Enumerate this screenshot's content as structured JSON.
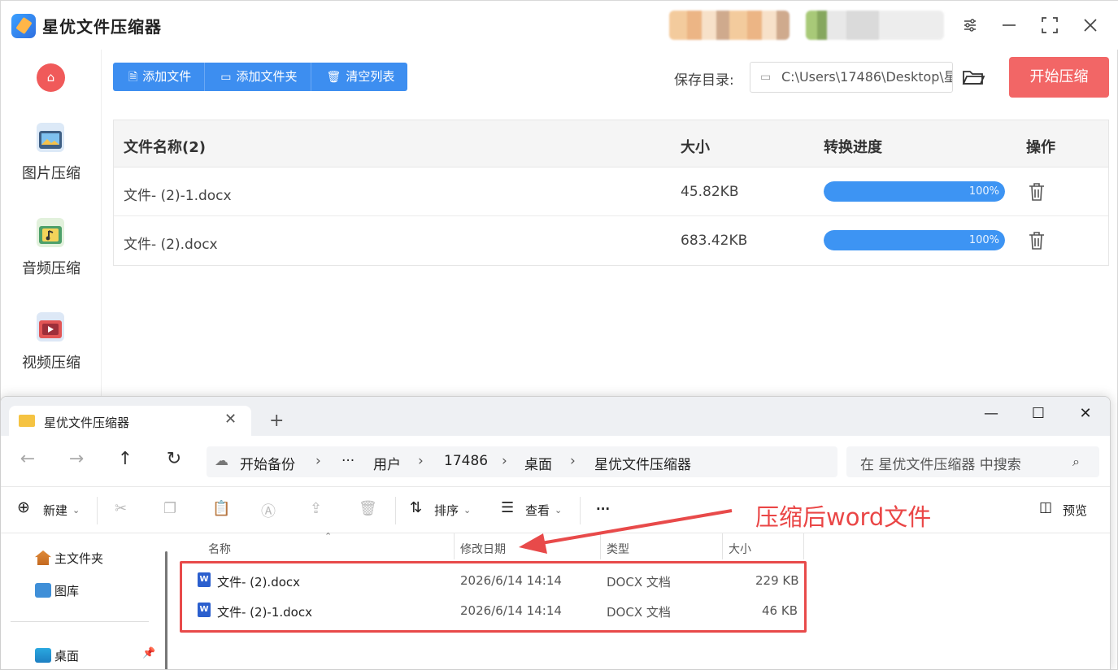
{
  "app": {
    "title": "星优文件压缩器",
    "sidebar": [
      {
        "label": "图片压缩",
        "icon": "image-compress-icon"
      },
      {
        "label": "音频压缩",
        "icon": "audio-compress-icon"
      },
      {
        "label": "视频压缩",
        "icon": "video-compress-icon"
      }
    ],
    "toolbar": {
      "add_file": "添加文件",
      "add_folder": "添加文件夹",
      "clear_list": "清空列表"
    },
    "save_dir_label": "保存目录:",
    "save_dir_value": "C:\\Users\\17486\\Desktop\\星",
    "start_label": "开始压缩",
    "table": {
      "headers": [
        "文件名称(2)",
        "大小",
        "转换进度",
        "操作"
      ],
      "rows": [
        {
          "name": "文件- (2)-1.docx",
          "size": "45.82KB",
          "progress": 100,
          "progress_label": "100%"
        },
        {
          "name": "文件- (2).docx",
          "size": "683.42KB",
          "progress": 100,
          "progress_label": "100%"
        }
      ]
    },
    "colors": {
      "primary": "#3d8ef0",
      "danger": "#f26666",
      "progress": "#3d94f3"
    }
  },
  "explorer": {
    "tab_title": "星优文件压缩器",
    "breadcrumb": [
      "开始备份",
      "···",
      "用户",
      "17486",
      "桌面",
      "星优文件压缩器"
    ],
    "search_placeholder": "在 星优文件压缩器 中搜索",
    "commands": {
      "new": "新建",
      "sort": "排序",
      "view": "查看",
      "more": "···",
      "preview": "预览"
    },
    "nav": [
      {
        "label": "主文件夹",
        "icon": "home-icon"
      },
      {
        "label": "图库",
        "icon": "gallery-icon"
      },
      {
        "label": "桌面",
        "icon": "desktop-icon"
      }
    ],
    "columns": [
      "名称",
      "修改日期",
      "类型",
      "大小"
    ],
    "files": [
      {
        "name": "文件- (2).docx",
        "date": "2026/6/14 14:14",
        "type": "DOCX 文档",
        "size": "229 KB"
      },
      {
        "name": "文件- (2)-1.docx",
        "date": "2026/6/14 14:14",
        "type": "DOCX 文档",
        "size": "46 KB"
      }
    ]
  },
  "annotation": {
    "text": "压缩后word文件",
    "color": "#ea4646"
  }
}
